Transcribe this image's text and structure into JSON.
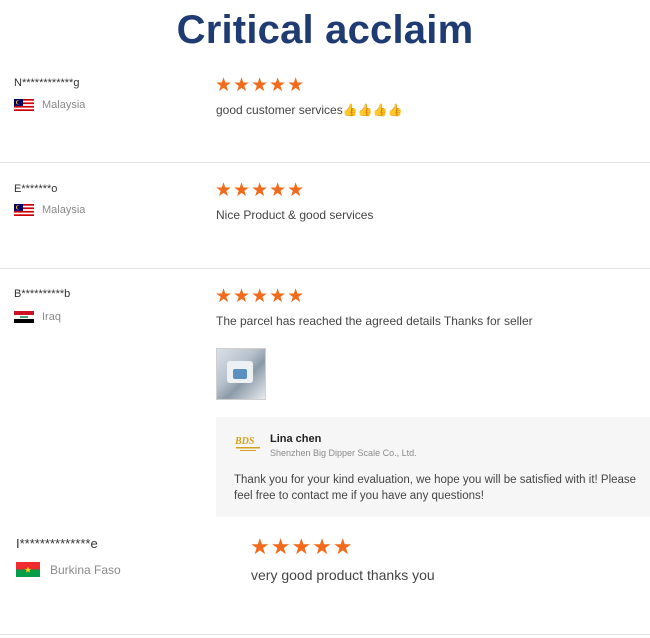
{
  "title": "Critical acclaim",
  "colors": {
    "title": "#1f3b73",
    "star": "#f26a1b"
  },
  "stars": "★★★★★",
  "reviews": [
    {
      "name": "N************g",
      "country": "Malaysia",
      "rating": 5,
      "text": "good customer services",
      "emoji": "👍👍👍👍"
    },
    {
      "name": "E*******o",
      "country": "Malaysia",
      "rating": 5,
      "text": "Nice Product & good services"
    },
    {
      "name": "B**********b",
      "country": "Iraq",
      "rating": 5,
      "text": "The parcel has reached the agreed details Thanks for seller",
      "reply": {
        "name": "Lina chen",
        "company": "Shenzhen Big Dipper Scale Co., Ltd.",
        "message": "Thank you for your kind evaluation, we hope you will be satisfied with it! Please feel free to contact me if you have any questions!"
      }
    },
    {
      "name": "I**************e",
      "country": "Burkina Faso",
      "rating": 5,
      "text": "very good product thanks you"
    }
  ]
}
